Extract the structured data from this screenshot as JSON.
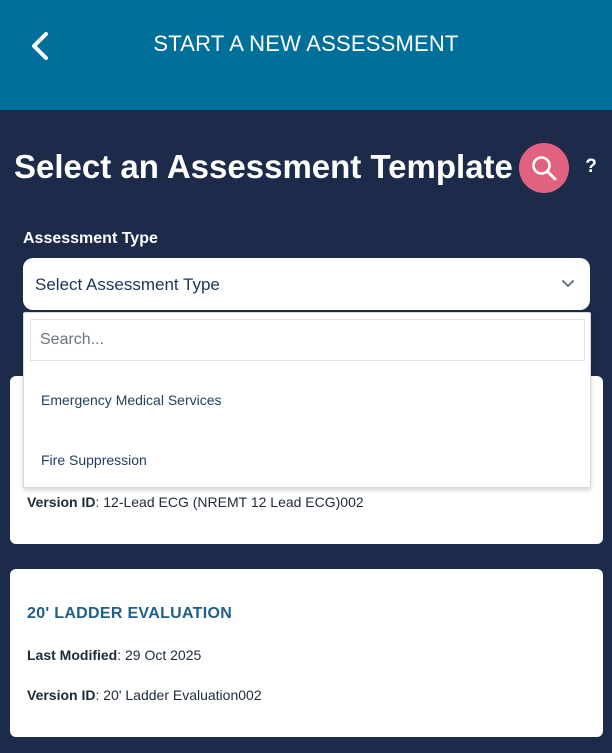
{
  "header": {
    "title": "START A NEW ASSESSMENT"
  },
  "page": {
    "title": "Select an Assessment Template",
    "help_label": "?"
  },
  "filter": {
    "label": "Assessment Type",
    "selected_value": "Select Assessment Type",
    "search_placeholder": "Search...",
    "options": [
      "Emergency Medical Services",
      "Fire Suppression"
    ]
  },
  "templates": [
    {
      "title": "",
      "last_modified_key": "",
      "last_modified_value": "",
      "version_key": "Version ID",
      "version_value": ": 12-Lead ECG (NREMT 12 Lead ECG)002"
    },
    {
      "title": "20' LADDER EVALUATION",
      "last_modified_key": "Last Modified",
      "last_modified_value": ": 29 Oct 2025",
      "version_key": "Version ID",
      "version_value": ": 20' Ladder Evaluation002"
    }
  ],
  "icons": {
    "back": "chevron-left-icon",
    "search": "search-icon",
    "dropdown": "chevron-down-icon"
  },
  "colors": {
    "header_bg": "#00709a",
    "page_bg": "#1c2b4a",
    "search_button_bg": "#e0627e",
    "card_title": "#1f5f8b"
  }
}
